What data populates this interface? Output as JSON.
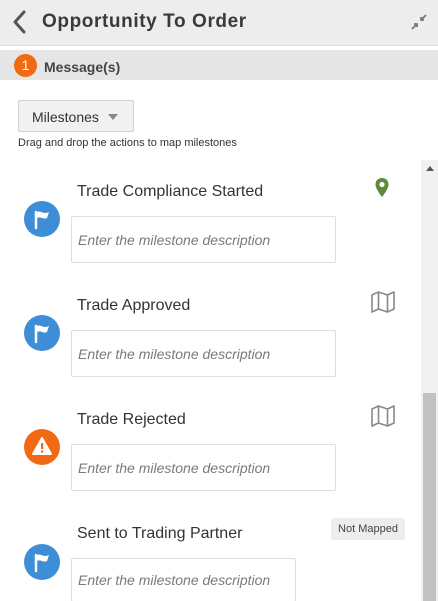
{
  "header": {
    "title": "Opportunity To Order",
    "back_icon": "chevron-left-icon",
    "collapse_icon": "collapse-arrows-icon"
  },
  "messages": {
    "count": "1",
    "label": "Message(s)",
    "badge_color": "#f06a13"
  },
  "toolbar": {
    "dropdown_value": "Milestones",
    "hint": "Drag and drop the actions to map milestones"
  },
  "milestones": [
    {
      "title": "Trade Compliance Started",
      "placeholder": "Enter the milestone description",
      "status_icon": "flag-icon",
      "status_color": "#3d8ed6",
      "map_state": "map-pin-icon",
      "map_color": "#5a8a3a"
    },
    {
      "title": "Trade Approved",
      "placeholder": "Enter the milestone description",
      "status_icon": "flag-icon",
      "status_color": "#3d8ed6",
      "map_state": "map-icon"
    },
    {
      "title": "Trade Rejected",
      "placeholder": "Enter the milestone description",
      "status_icon": "warning-icon",
      "status_color": "#ef6a13",
      "map_state": "map-icon"
    },
    {
      "title": "Sent to Trading Partner",
      "placeholder": "Enter the milestone description",
      "status_icon": "flag-icon",
      "status_color": "#3d8ed6",
      "map_state": "Not Mapped"
    }
  ]
}
